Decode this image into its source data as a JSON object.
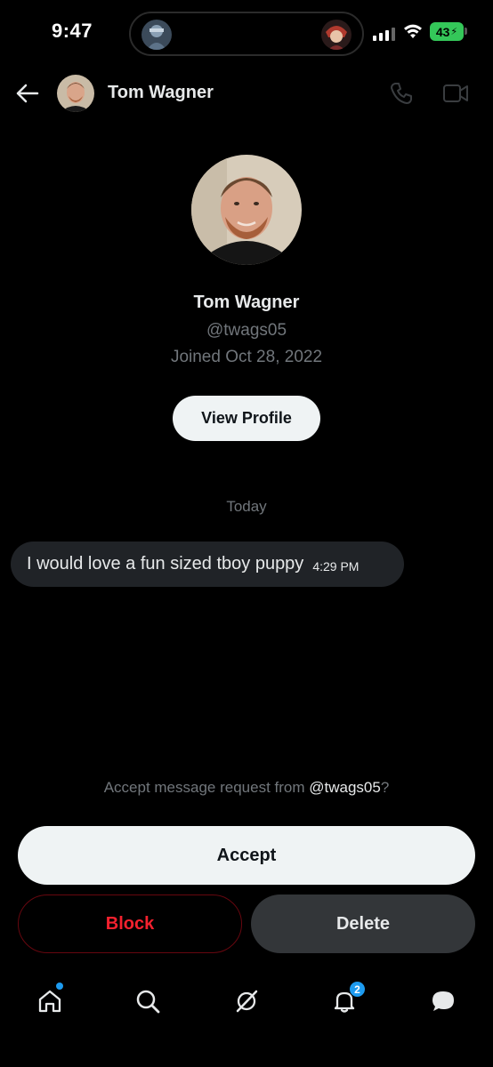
{
  "status_bar": {
    "time": "9:47",
    "battery": "43"
  },
  "header": {
    "name": "Tom Wagner"
  },
  "profile": {
    "name": "Tom Wagner",
    "handle": "@twags05",
    "joined": "Joined Oct 28, 2022",
    "view_profile_label": "View Profile"
  },
  "conversation": {
    "day_label": "Today",
    "message": {
      "text": "I would love a fun sized tboy puppy",
      "time": "4:29 PM"
    }
  },
  "request": {
    "prompt_prefix": "Accept message request from ",
    "prompt_handle": "@twags05",
    "prompt_suffix": "?",
    "accept_label": "Accept",
    "block_label": "Block",
    "delete_label": "Delete"
  },
  "tab_bar": {
    "items": [
      {
        "icon": "home-icon",
        "has_dot": true
      },
      {
        "icon": "search-icon"
      },
      {
        "icon": "grok-icon"
      },
      {
        "icon": "notifications-icon",
        "badge": "2"
      },
      {
        "icon": "messages-icon"
      }
    ]
  },
  "colors": {
    "background": "#000000",
    "accent": "#1d9bf0",
    "danger": "#f4212e",
    "battery": "#34c759",
    "muted_text": "#71767b",
    "bubble": "#202327"
  }
}
